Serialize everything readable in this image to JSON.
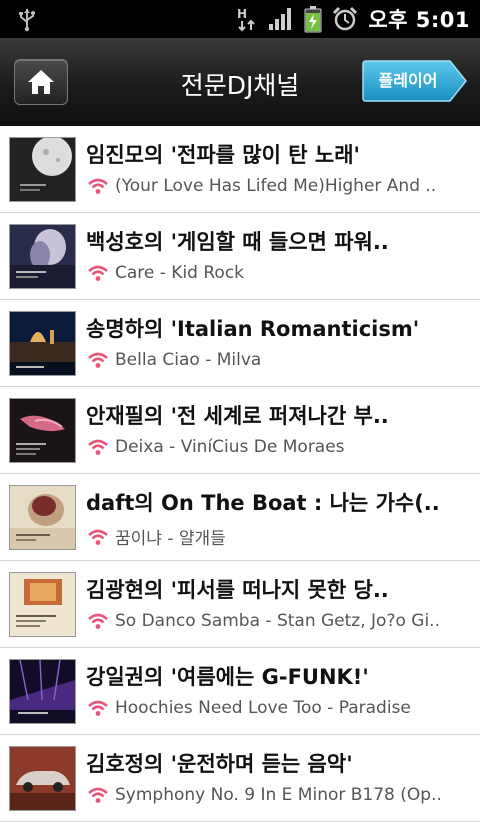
{
  "status_bar": {
    "time": "오후 5:01",
    "icons": [
      "usb-icon",
      "hsdpa-icon",
      "signal-icon",
      "battery-charging-icon",
      "alarm-icon"
    ]
  },
  "header": {
    "title": "전문DJ채널",
    "home_icon": "home-icon",
    "player_label": "플레이어"
  },
  "colors": {
    "accent_blue": "#2aa9d8",
    "wifi_pink": "#e8557a",
    "header_dark": "#1b1b1b"
  },
  "channels": [
    {
      "title": "임진모의 '전파를 많이 탄 노래'",
      "subtitle": "(Your Love Has Lifed Me)Higher And .."
    },
    {
      "title": "백성호의 '게임할 때 들으면 파워..",
      "subtitle": "Care - Kid Rock"
    },
    {
      "title": "송명하의 'Italian Romanticism'",
      "subtitle": "Bella Ciao - Milva"
    },
    {
      "title": "안재필의 '전 세계로 퍼져나간 부..",
      "subtitle": "Deixa - ViníCius De Moraes"
    },
    {
      "title": "daft의 On The Boat : 나는 가수(..",
      "subtitle": "꿈이냐 - 얄개들"
    },
    {
      "title": "김광현의 '피서를 떠나지 못한 당..",
      "subtitle": "So Danco Samba - Stan Getz, Jo?o Gi.."
    },
    {
      "title": "강일권의 '여름에는 G-FUNK!'",
      "subtitle": "Hoochies Need Love Too - Paradise"
    },
    {
      "title": "김호정의 '운전하며 듣는 음악'",
      "subtitle": "Symphony No. 9 In E Minor B178 (Op.."
    }
  ]
}
